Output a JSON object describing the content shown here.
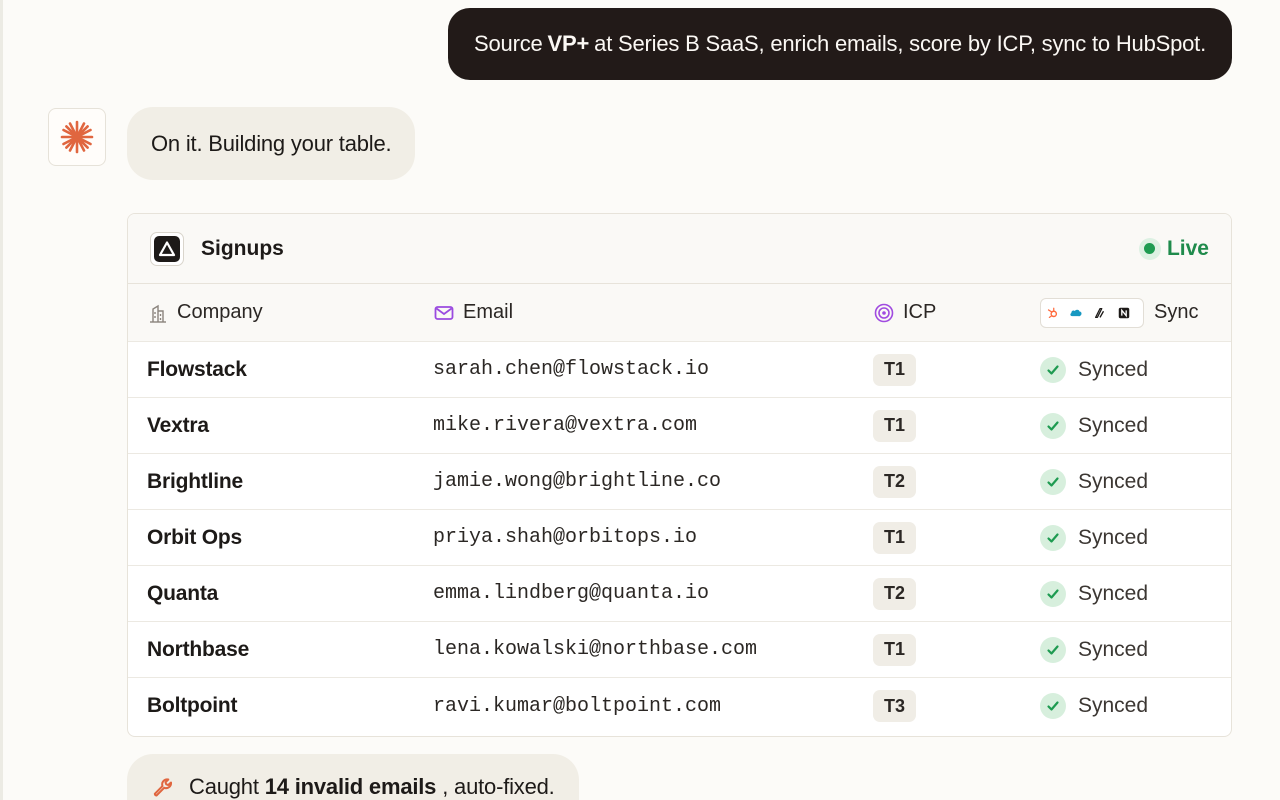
{
  "user_message": {
    "before": "Source",
    "bold": "VP+",
    "after": "at Series B SaaS, enrich emails, score by ICP, sync to HubSpot."
  },
  "assistant_message": "On it. Building your table.",
  "table": {
    "title": "Signups",
    "status": "Live",
    "columns": {
      "company": "Company",
      "email": "Email",
      "icp": "ICP",
      "sync": "Sync"
    },
    "rows": [
      {
        "company": "Flowstack",
        "email": "sarah.chen@flowstack.io",
        "icp": "T1",
        "sync": "Synced"
      },
      {
        "company": "Vextra",
        "email": "mike.rivera@vextra.com",
        "icp": "T1",
        "sync": "Synced"
      },
      {
        "company": "Brightline",
        "email": "jamie.wong@brightline.co",
        "icp": "T2",
        "sync": "Synced"
      },
      {
        "company": "Orbit Ops",
        "email": "priya.shah@orbitops.io",
        "icp": "T1",
        "sync": "Synced"
      },
      {
        "company": "Quanta",
        "email": "emma.lindberg@quanta.io",
        "icp": "T2",
        "sync": "Synced"
      },
      {
        "company": "Northbase",
        "email": "lena.kowalski@northbase.com",
        "icp": "T1",
        "sync": "Synced"
      },
      {
        "company": "Boltpoint",
        "email": "ravi.kumar@boltpoint.com",
        "icp": "T3",
        "sync": "Synced"
      }
    ]
  },
  "note": {
    "before": "Caught",
    "bold": "14 invalid emails",
    "after": ", auto-fixed."
  },
  "icons": {
    "avatar": "asterisk-burst-icon",
    "app": "triangle-logo-icon",
    "company": "building-icon",
    "email": "mail-icon",
    "icp": "target-icon",
    "sync_tools": [
      "hubspot-icon",
      "salesforce-icon",
      "pen-icon",
      "notion-icon"
    ],
    "synced": "check-icon",
    "note": "wrench-icon"
  },
  "colors": {
    "accent_orange": "#e0663f",
    "live_green": "#1f8b4c",
    "user_bubble": "#221a18",
    "assistant_bubble": "#f1eee6"
  }
}
